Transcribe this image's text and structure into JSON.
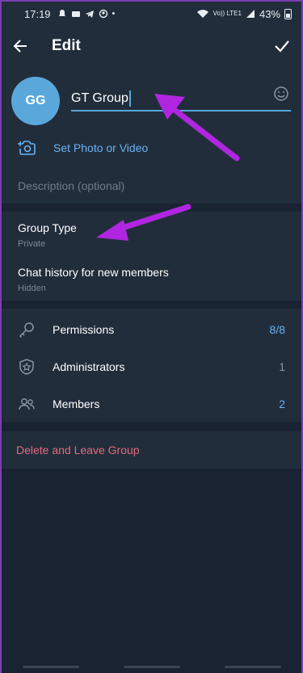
{
  "status_bar": {
    "time": "17:19",
    "network": "Vo)) LTE1",
    "battery": "43%"
  },
  "app_bar": {
    "title": "Edit",
    "back_icon": "arrow-left-icon",
    "confirm_icon": "check-icon"
  },
  "group": {
    "avatar_initials": "GG",
    "avatar_color": "#5aa7dc",
    "name_value": "GT Group",
    "set_photo_label": "Set Photo or Video",
    "description_placeholder": "Description (optional)"
  },
  "settings": [
    {
      "title": "Group Type",
      "value": "Private"
    },
    {
      "title": "Chat history for new members",
      "value": "Hidden"
    }
  ],
  "counts": [
    {
      "label": "Permissions",
      "value": "8/8",
      "icon": "key-icon"
    },
    {
      "label": "Administrators",
      "value": "1",
      "icon": "shield-star-icon"
    },
    {
      "label": "Members",
      "value": "2",
      "icon": "people-icon"
    }
  ],
  "danger": {
    "delete_label": "Delete and Leave Group",
    "color": "#e66a7a"
  },
  "colors": {
    "accent": "#5aa7dc",
    "link": "#6ab3f3",
    "annotation_arrow": "#b026e0"
  }
}
